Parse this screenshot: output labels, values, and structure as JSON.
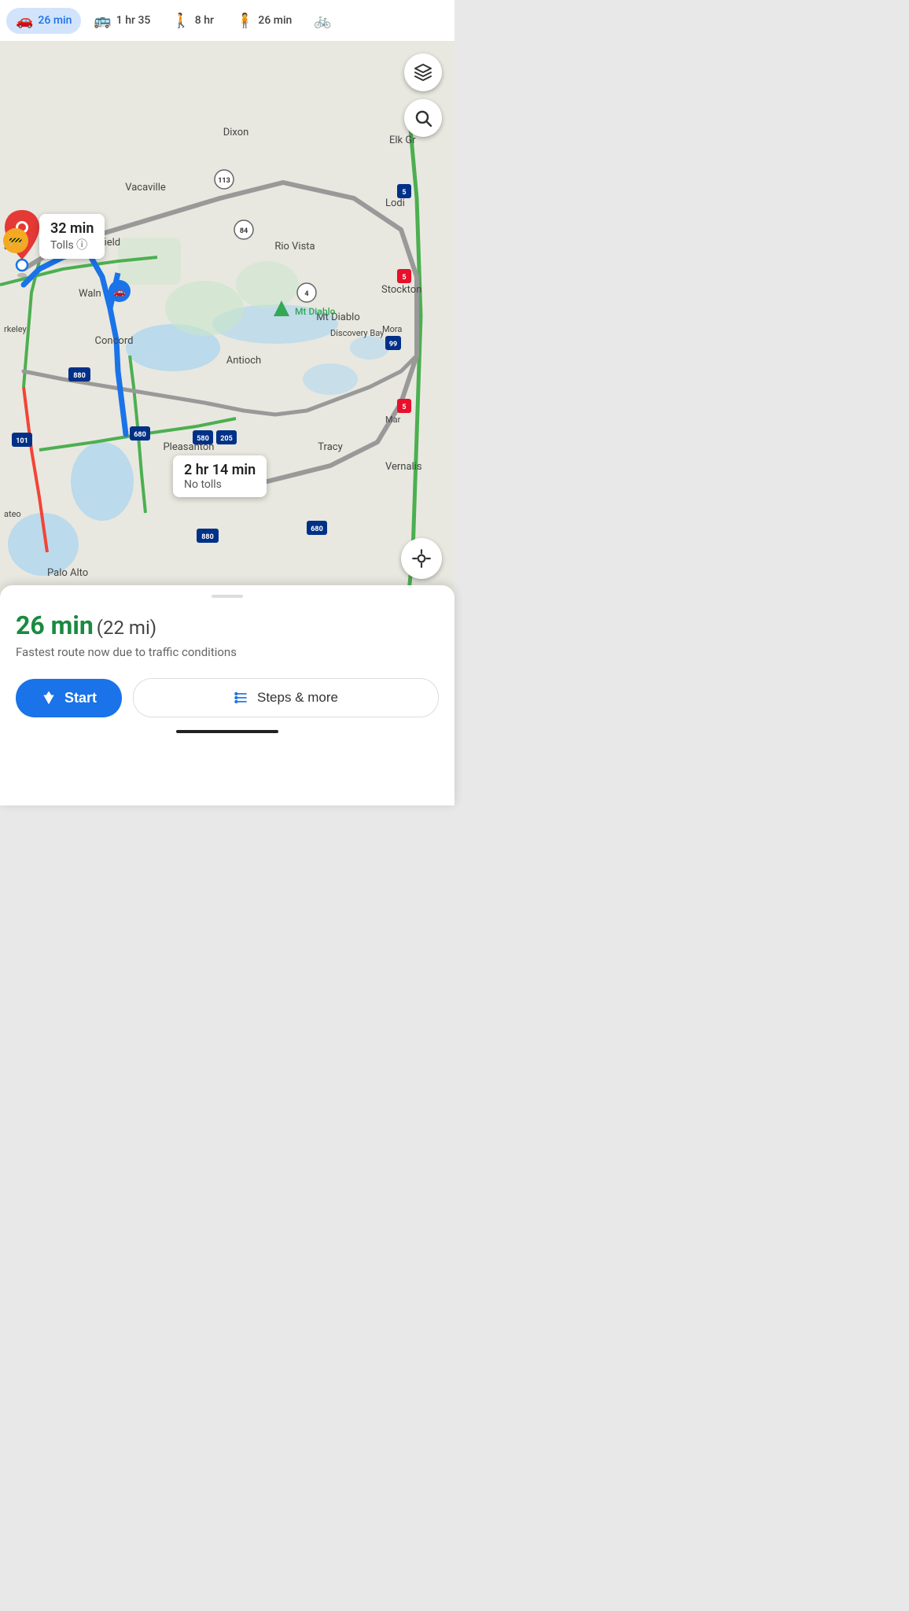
{
  "transport_bar": {
    "modes": [
      {
        "id": "drive",
        "label": "26 min",
        "icon": "🚗",
        "active": true
      },
      {
        "id": "transit",
        "label": "1 hr 35",
        "icon": "🚌",
        "active": false
      },
      {
        "id": "walk",
        "label": "8 hr",
        "icon": "🚶",
        "active": false
      },
      {
        "id": "ride",
        "label": "26 min",
        "icon": "🧍",
        "active": false
      },
      {
        "id": "bike",
        "label": "...",
        "icon": "🚲",
        "active": false
      }
    ]
  },
  "map": {
    "buttons": {
      "layers": "⬡",
      "search": "🔍",
      "location": "⊙"
    }
  },
  "route_popups": [
    {
      "id": "tolls",
      "time": "32 min",
      "detail": "Tolls ⓘ"
    },
    {
      "id": "no-tolls",
      "time": "2 hr 14 min",
      "detail": "No tolls"
    }
  ],
  "map_labels": {
    "dixon": "Dixon",
    "vacaville": "Vacaville",
    "fairfield": "Fairfield",
    "elk_grove": "Elk Gr",
    "rio_vista": "Rio Vista",
    "antioch": "Antioch",
    "concord": "Concord",
    "mt_diablo": "Mt Diablo",
    "discovery_bay": "Discovery Bay",
    "stockton": "Stockton",
    "pleasanton": "Pleasanton",
    "tracy": "Tracy",
    "vernalis": "Vernalis",
    "palo_alto": "Palo Alto",
    "lodi": "Lodi"
  },
  "bottom_panel": {
    "duration": "26 min",
    "distance": "(22 mi)",
    "subtitle": "Fastest route now due to traffic conditions",
    "start_label": "Start",
    "steps_label": "Steps & more"
  }
}
